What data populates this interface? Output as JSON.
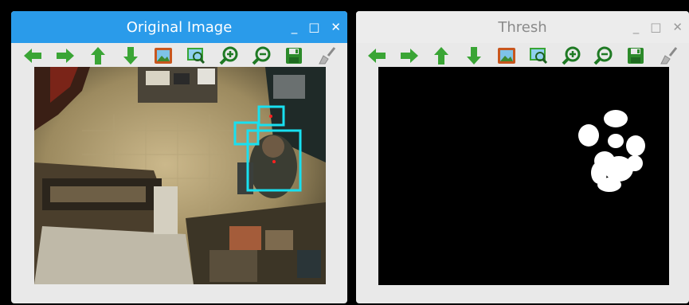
{
  "windows": [
    {
      "title": "Original Image",
      "controls": {
        "minimize": "_",
        "maximize": "□",
        "close": "✕"
      }
    },
    {
      "title": "Thresh",
      "controls": {
        "minimize": "_",
        "maximize": "□",
        "close": "✕"
      }
    }
  ],
  "toolbar_icons": [
    "arrow-left-icon",
    "arrow-right-icon",
    "arrow-up-icon",
    "arrow-down-icon",
    "image-icon",
    "image-zoom-icon",
    "zoom-in-icon",
    "zoom-out-icon",
    "save-icon",
    "brush-icon"
  ],
  "colors": {
    "active_titlebar": "#2a9bea",
    "inactive_titlebar": "#ececec",
    "arrow_green": "#3aa535",
    "detection_box": "#18e0f0",
    "detection_point": "#ff2020"
  }
}
